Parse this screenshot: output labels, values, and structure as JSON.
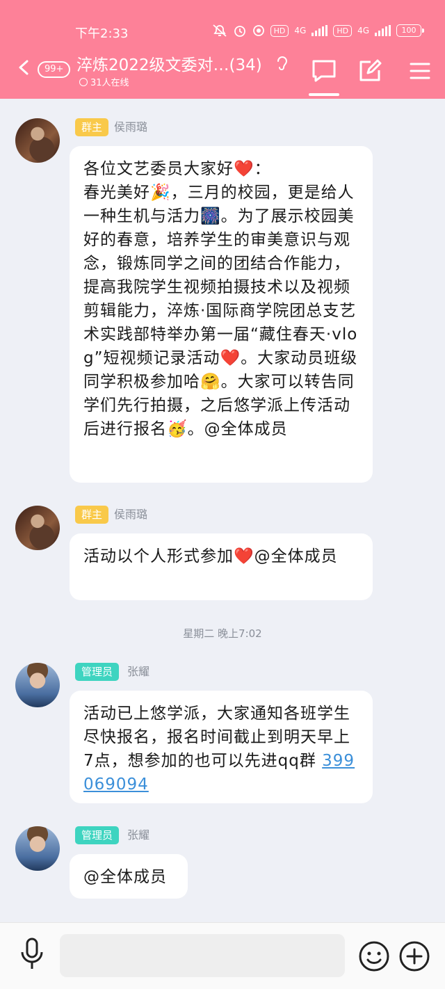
{
  "status_bar": {
    "time": "下午2:33",
    "hd1": "HD",
    "net1": "4G",
    "hd2": "HD",
    "net2": "4G",
    "battery": "100"
  },
  "header": {
    "unread_badge": "99+",
    "title": "淬炼2022级文委对…(34)",
    "online": "31人在线",
    "accent_color": "#fd8198"
  },
  "messages": [
    {
      "role": "群主",
      "sender": "侯雨璐",
      "text": "各位文艺委员大家好❤️：\n春光美好🎉，三月的校园，更是给人一种生机与活力🎆。为了展示校园美好的春意，培养学生的审美意识与观念，锻炼同学之间的团结合作能力，提高我院学生视频拍摄技术以及视频剪辑能力，淬炼·国际商学院团总支艺术实践部特举办第一届“藏住春天·vlog”短视频记录活动❤️。大家动员班级同学积极参加哈🤗。大家可以转告同学们先行拍摄，之后悠学派上传活动后进行报名🥳。@全体成员"
    },
    {
      "role": "群主",
      "sender": "侯雨璐",
      "text": "活动以个人形式参加❤️@全体成员"
    },
    {
      "role": "管理员",
      "sender": "张耀",
      "text": "活动已上悠学派，大家通知各班学生尽快报名，报名时间截止到明天早上7点，想参加的也可以先进qq群 ",
      "link": "399069094"
    },
    {
      "role": "管理员",
      "sender": "张耀",
      "text": "@全体成员"
    }
  ],
  "timestamp": "星期二 晚上7:02",
  "icons": {
    "back": "chevron-left-icon",
    "chat": "chat-bubble-icon",
    "edit": "edit-icon",
    "menu": "menu-icon",
    "ear": "ear-icon",
    "mic": "microphone-icon",
    "emoji": "emoji-icon",
    "plus": "plus-circle-icon"
  }
}
